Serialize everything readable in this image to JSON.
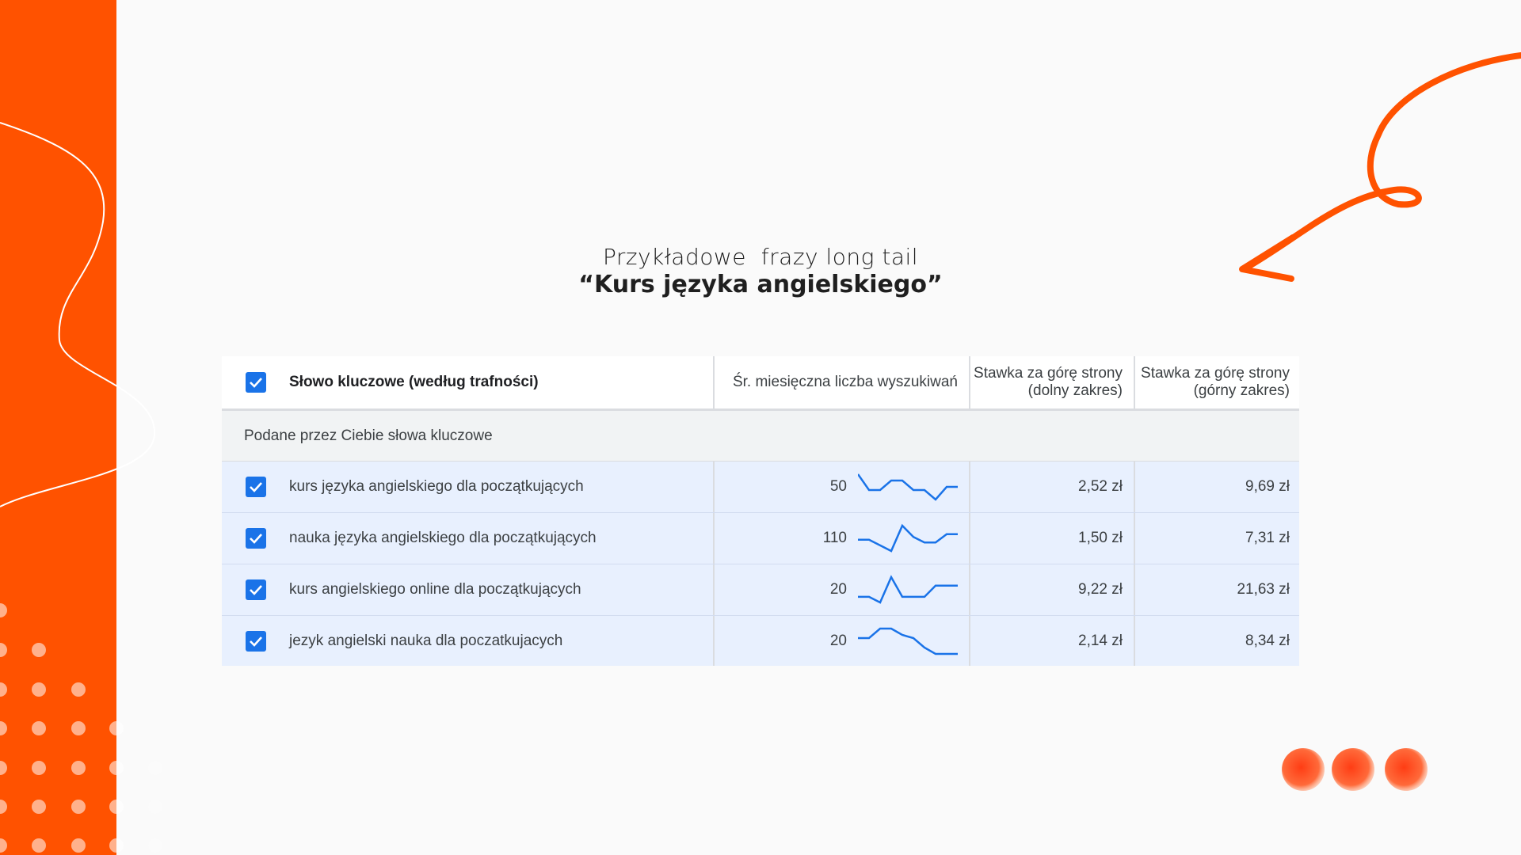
{
  "accent_color": "#ff5200",
  "check_color": "#1a73e8",
  "heading": {
    "subtitle": "Przykładowe  frazy long tail",
    "title": "“Kurs języka angielskiego”"
  },
  "table": {
    "headers": {
      "keyword": "Słowo kluczowe (według trafności)",
      "avg_searches": "Śr. miesięczna liczba wyszukiwań",
      "bid_low": "Stawka za górę strony (dolny zakres)",
      "bid_high": "Stawka za górę strony (górny zakres)"
    },
    "group_label": "Podane przez Ciebie słowa kluczowe",
    "rows": [
      {
        "keyword": "kurs języka angielskiego dla początkujących",
        "searches": "50",
        "bid_low": "2,52 zł",
        "bid_high": "9,69 zł",
        "checked": true,
        "trend": [
          8,
          3,
          3,
          6,
          6,
          3,
          3,
          0,
          4,
          4
        ]
      },
      {
        "keyword": "nauka języka angielskiego dla początkujących",
        "searches": "110",
        "bid_low": "1,50 zł",
        "bid_high": "7,31 zł",
        "checked": true,
        "trend": [
          4,
          4,
          2,
          0,
          9,
          5,
          3,
          3,
          6,
          6
        ]
      },
      {
        "keyword": "kurs angielskiego online dla początkujących",
        "searches": "20",
        "bid_low": "9,22 zł",
        "bid_high": "21,63 zł",
        "checked": true,
        "trend": [
          2,
          2,
          0,
          9,
          2,
          2,
          2,
          6,
          6,
          6
        ]
      },
      {
        "keyword": "jezyk angielski nauka dla poczatkujacych",
        "searches": "20",
        "bid_low": "2,14 zł",
        "bid_high": "8,34 zł",
        "checked": true,
        "trend": [
          6,
          6,
          9,
          9,
          7,
          6,
          3,
          1,
          1,
          1
        ]
      }
    ]
  }
}
